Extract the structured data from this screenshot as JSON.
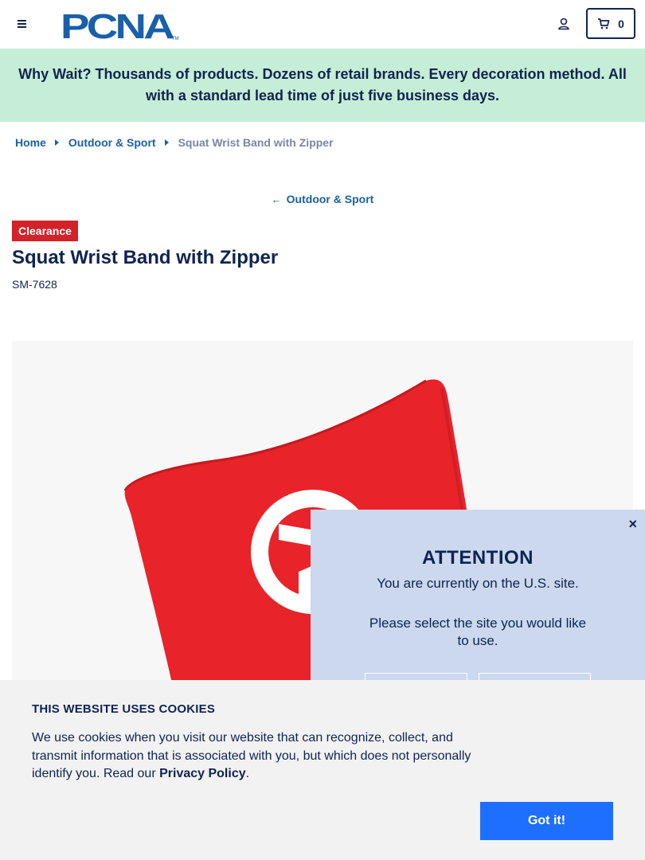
{
  "header": {
    "logo_text": "PCNA",
    "cart_count": "0"
  },
  "banner": {
    "text": "Why Wait? Thousands of products. Dozens of retail brands. Every decoration method. All with a standard lead time of just five business days."
  },
  "breadcrumb": {
    "items": [
      "Home",
      "Outdoor & Sport"
    ],
    "current": "Squat Wrist Band with Zipper"
  },
  "back_link": {
    "arrow": "←",
    "label": "Outdoor & Sport"
  },
  "product": {
    "badge": "Clearance",
    "title": "Squat Wrist Band with Zipper",
    "sku": "SM-7628",
    "image_color": "#e8232a"
  },
  "attention": {
    "close": "×",
    "title": "ATTENTION",
    "text": "You are currently on the U.S. site.",
    "prompt": "Please select the site you would like to use."
  },
  "cookie": {
    "title": "THIS WEBSITE USES COOKIES",
    "text": "We use cookies when you visit our website that can recognize, collect, and transmit information that is associated with you, but which does not personally identify you. Read our ",
    "link": "Privacy Policy",
    "after": ".",
    "button": "Got it!"
  },
  "colors": {
    "navy": "#0f2352",
    "link_blue": "#1a5fa8",
    "banner_green": "#c6eed6",
    "clearance_red": "#d2232a",
    "modal_blue": "#cbd8ee",
    "button_blue": "#1f6fff"
  }
}
